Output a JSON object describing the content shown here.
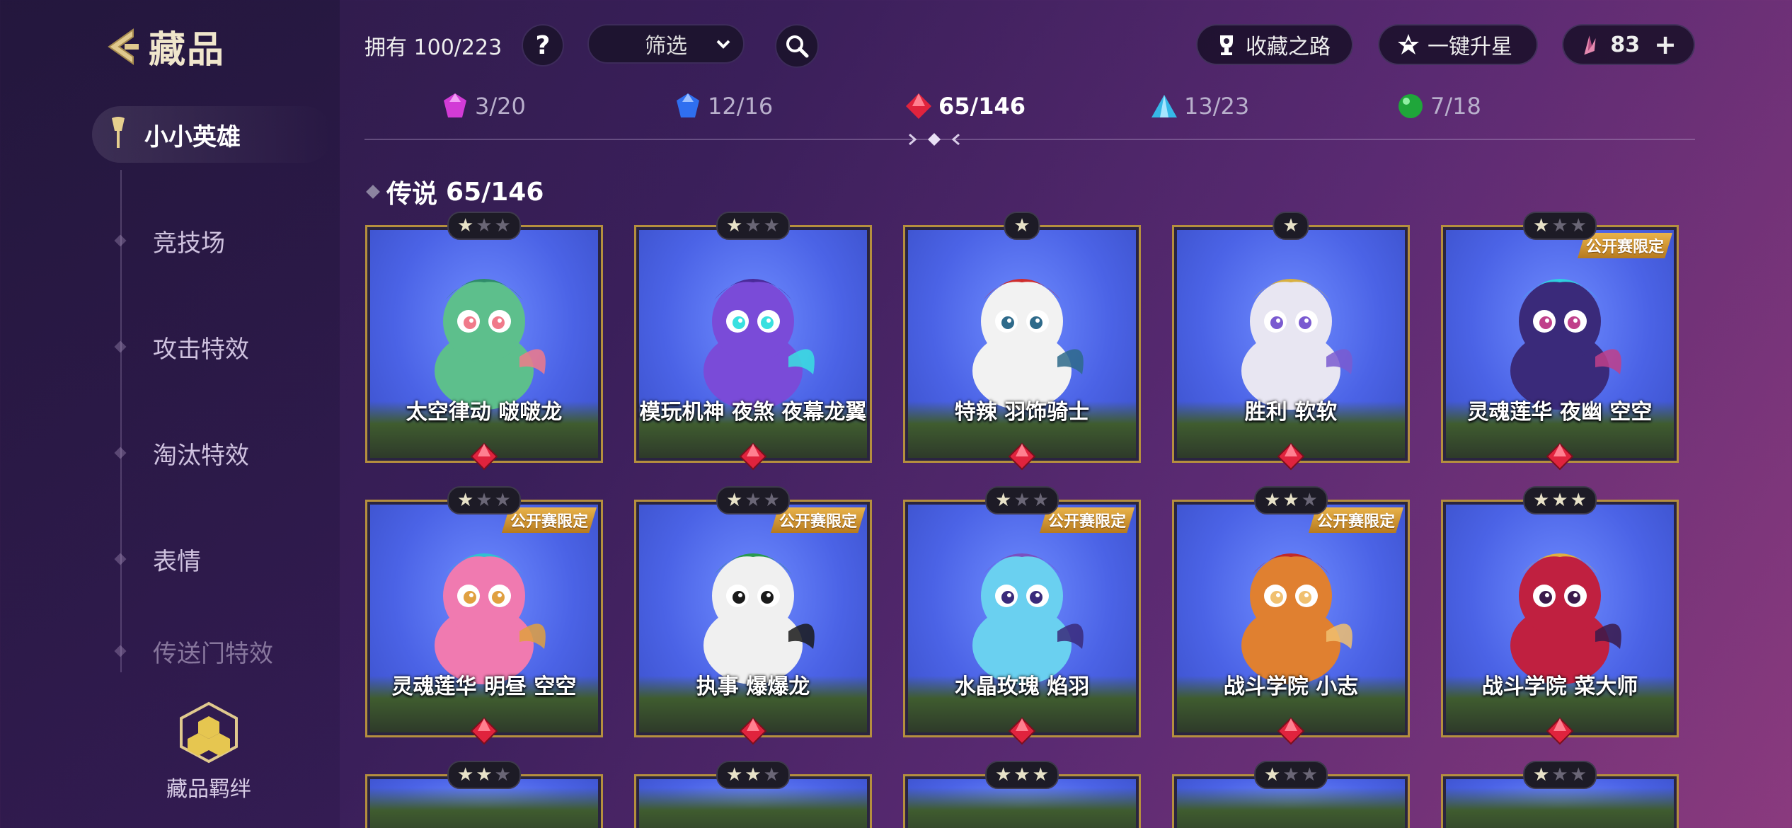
{
  "header": {
    "title": "藏品",
    "owned_label": "拥有 100/223",
    "help_label": "?",
    "filter_label": "筛选",
    "collection_path_label": "收藏之路",
    "upgrade_label": "一键升星",
    "currency_value": "83",
    "plus_label": "+"
  },
  "sidebar": {
    "items": [
      {
        "label": "小小英雄"
      },
      {
        "label": "竞技场"
      },
      {
        "label": "攻击特效"
      },
      {
        "label": "淘汰特效"
      },
      {
        "label": "表情"
      },
      {
        "label": "传送门特效"
      }
    ],
    "bonds_label": "藏品羁绊"
  },
  "rarity_tabs": [
    {
      "count": "3/20",
      "color": "#d23bd6"
    },
    {
      "count": "12/16",
      "color": "#2f6ff0"
    },
    {
      "count": "65/146",
      "color": "#e0233d"
    },
    {
      "count": "13/23",
      "color": "#36b8e8"
    },
    {
      "count": "7/18",
      "color": "#1fa63a"
    }
  ],
  "section": {
    "title": "传说",
    "count": "65/146"
  },
  "cards": [
    {
      "name": "太空律动 啵啵龙",
      "stars": 1,
      "limited": ""
    },
    {
      "name": "模玩机神 夜煞 夜幕龙翼",
      "stars": 1,
      "limited": ""
    },
    {
      "name": "特辣 羽饰骑士",
      "stars": 1,
      "limited": ""
    },
    {
      "name": "胜利 软软",
      "stars": 1,
      "limited": ""
    },
    {
      "name": "灵魂莲华 夜幽 空空",
      "stars": 1,
      "limited": "公开赛限定"
    },
    {
      "name": "灵魂莲华 明昼 空空",
      "stars": 1,
      "limited": "公开赛限定"
    },
    {
      "name": "执事 爆爆龙",
      "stars": 1,
      "limited": "公开赛限定"
    },
    {
      "name": "水晶玫瑰 焰羽",
      "stars": 1,
      "limited": "公开赛限定"
    },
    {
      "name": "战斗学院 小志",
      "stars": 2,
      "limited": "公开赛限定"
    },
    {
      "name": "战斗学院 菜大师",
      "stars": 3,
      "limited": ""
    },
    {
      "name": "",
      "stars": 2,
      "limited": ""
    },
    {
      "name": "",
      "stars": 2,
      "limited": ""
    },
    {
      "name": "",
      "stars": 3,
      "limited": ""
    },
    {
      "name": "",
      "stars": 1,
      "limited": ""
    },
    {
      "name": "",
      "stars": 1,
      "limited": ""
    }
  ]
}
